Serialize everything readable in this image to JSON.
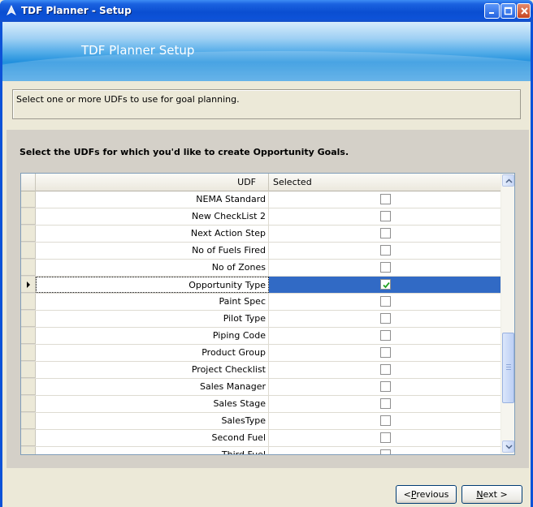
{
  "window": {
    "title": "TDF Planner - Setup"
  },
  "banner": {
    "title": "TDF Planner Setup"
  },
  "description": "Select one or more UDFs to use for goal planning.",
  "panel": {
    "heading": "Select the UDFs for which you'd like to create Opportunity Goals."
  },
  "grid": {
    "columns": {
      "udf": "UDF",
      "selected": "Selected"
    },
    "rows": [
      {
        "udf": "NEMA Standard",
        "selected": false
      },
      {
        "udf": "New CheckList 2",
        "selected": false
      },
      {
        "udf": "Next Action Step",
        "selected": false
      },
      {
        "udf": "No of Fuels Fired",
        "selected": false
      },
      {
        "udf": "No of Zones",
        "selected": false
      },
      {
        "udf": "Opportunity Type",
        "selected": true,
        "current": true
      },
      {
        "udf": "Paint Spec",
        "selected": false
      },
      {
        "udf": "Pilot Type",
        "selected": false
      },
      {
        "udf": "Piping Code",
        "selected": false
      },
      {
        "udf": "Product Group",
        "selected": false
      },
      {
        "udf": "Project Checklist",
        "selected": false
      },
      {
        "udf": "Sales Manager",
        "selected": false
      },
      {
        "udf": "Sales Stage",
        "selected": false
      },
      {
        "udf": "SalesType",
        "selected": false
      },
      {
        "udf": "Second Fuel",
        "selected": false
      },
      {
        "udf": "Third Fuel",
        "selected": false
      }
    ]
  },
  "buttons": {
    "previous": {
      "mnemonic": "P",
      "rest": "revious",
      "prefix": "<"
    },
    "next": {
      "mnemonic": "N",
      "rest": "ext",
      "suffix": " >"
    }
  },
  "colors": {
    "title_bar": "#0a4ed1",
    "selection": "#316ac5",
    "panel": "#d4d0c8"
  }
}
